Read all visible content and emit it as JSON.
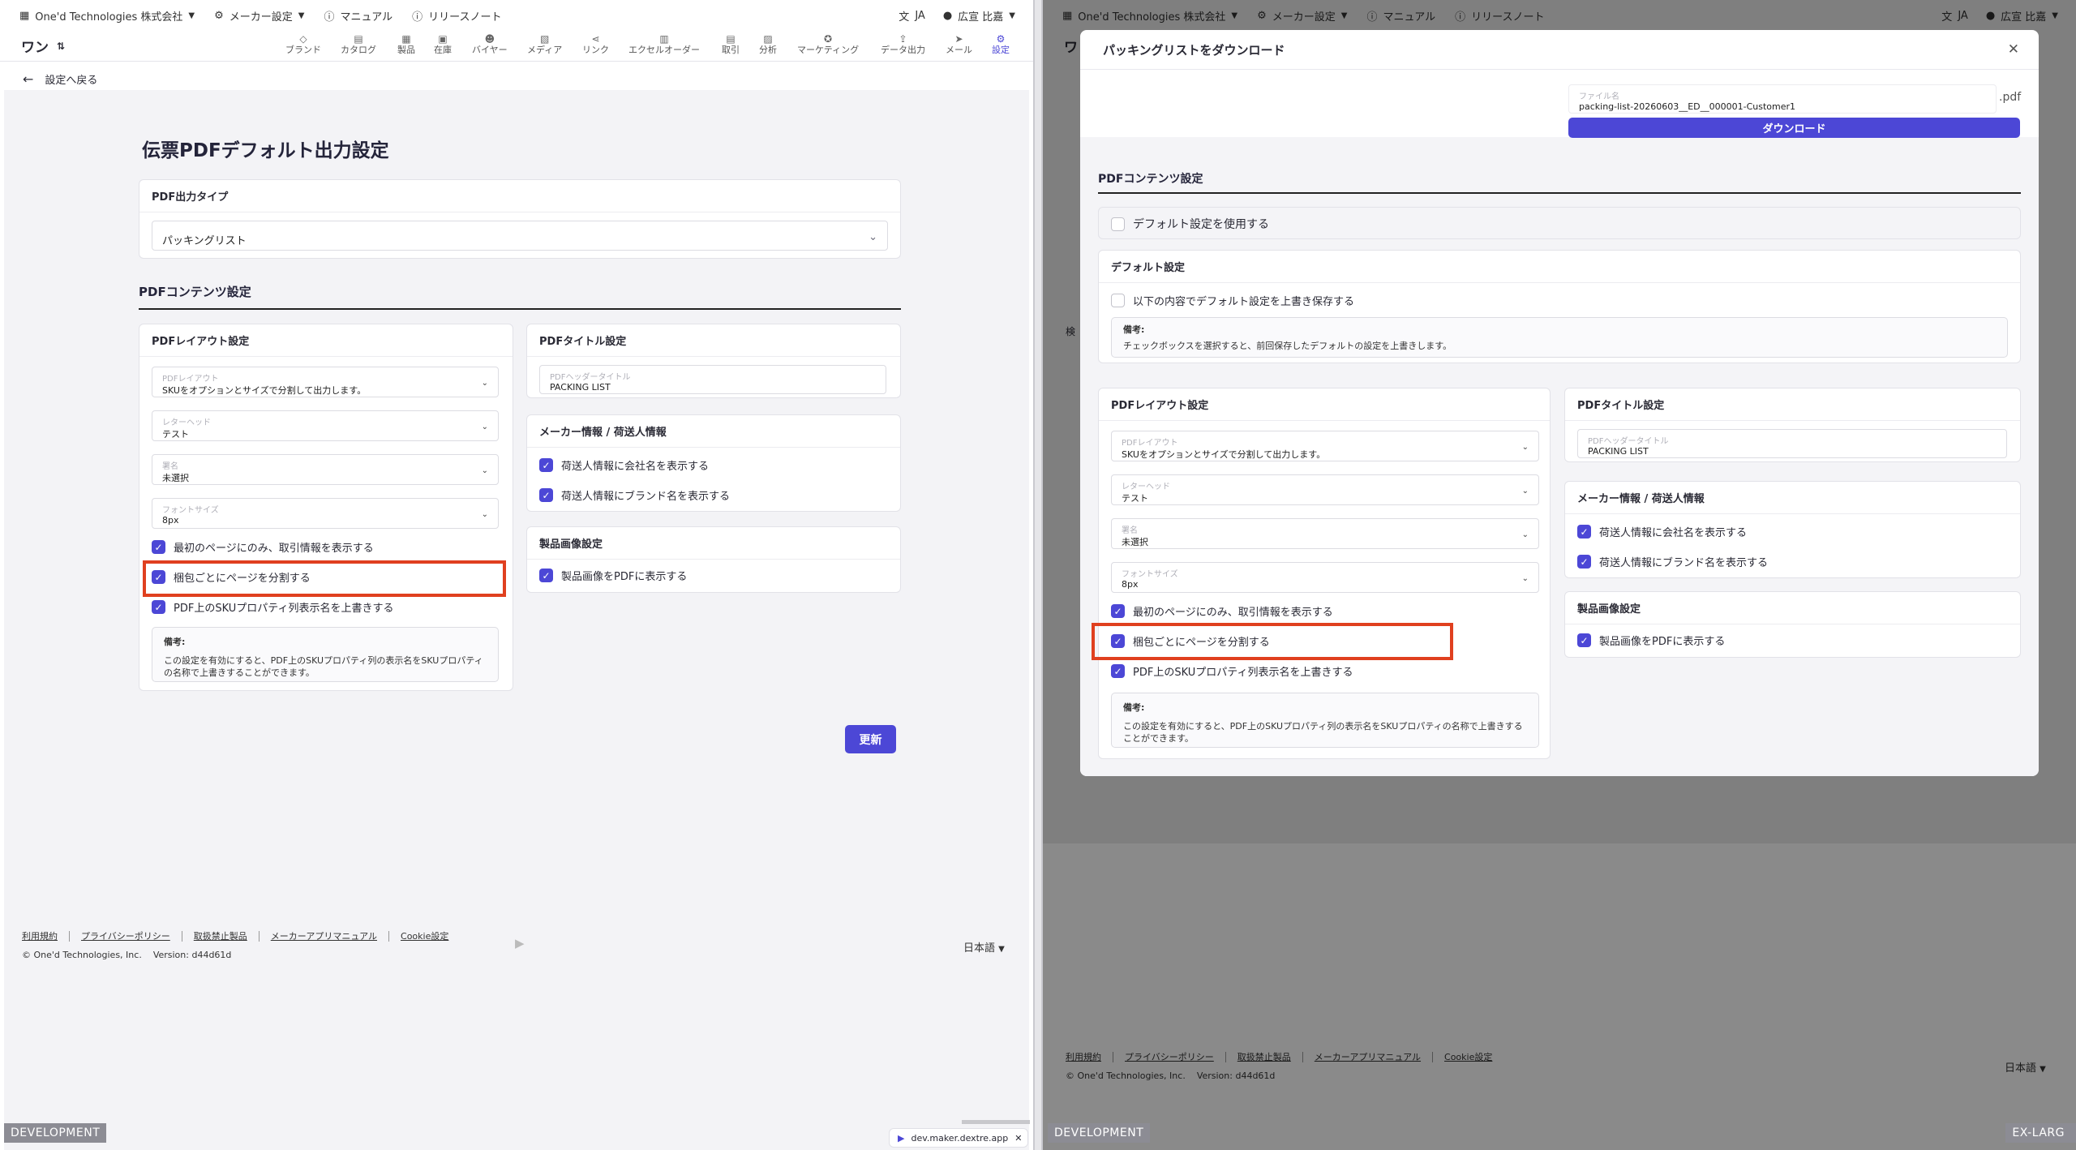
{
  "topbar": {
    "company": "One'd Technologies 株式会社",
    "maker_settings": "メーカー設定",
    "manual": "マニュアル",
    "release_notes": "リリースノート",
    "lang": "JA",
    "user": "広宣 比嘉"
  },
  "nav": {
    "logo": "ワン",
    "items": [
      "ブランド",
      "カタログ",
      "製品",
      "在庫",
      "バイヤー",
      "メディア",
      "リンク",
      "エクセルオーダー",
      "取引",
      "分析",
      "マーケティング",
      "データ出力",
      "メール",
      "設定"
    ]
  },
  "back_label": "設定へ戻る",
  "page_title": "伝票PDFデフォルト出力設定",
  "output_type": {
    "heading": "PDF出力タイプ",
    "value": "パッキングリスト"
  },
  "pdf_contents_heading": "PDFコンテンツ設定",
  "layout": {
    "heading": "PDFレイアウト設定",
    "fields": [
      {
        "label": "PDFレイアウト",
        "value": "SKUをオプションとサイズで分割して出力します。"
      },
      {
        "label": "レターヘッド",
        "value": "テスト"
      },
      {
        "label": "署名",
        "value": "未選択"
      },
      {
        "label": "フォントサイズ",
        "value": "8px"
      }
    ],
    "checks": [
      {
        "label": "最初のページにのみ、取引情報を表示する",
        "checked": true
      },
      {
        "label": "梱包ごとにページを分割する",
        "checked": true
      },
      {
        "label": "PDF上のSKUプロパティ列表示名を上書きする",
        "checked": true
      }
    ],
    "note_title": "備考:",
    "note_text": "この設定を有効にすると、PDF上のSKUプロパティ列の表示名をSKUプロパティの名称で上書きすることができます。"
  },
  "title_settings": {
    "heading": "PDFタイトル設定",
    "field_label": "PDFヘッダータイトル",
    "field_value": "PACKING LIST"
  },
  "maker_info": {
    "heading": "メーカー情報 / 荷送人情報",
    "checks": [
      {
        "label": "荷送人情報に会社名を表示する",
        "checked": true
      },
      {
        "label": "荷送人情報にブランド名を表示する",
        "checked": true
      }
    ]
  },
  "product_image": {
    "heading": "製品画像設定",
    "checks": [
      {
        "label": "製品画像をPDFに表示する",
        "checked": true
      }
    ]
  },
  "update_button": "更新",
  "footer": {
    "links": [
      "利用規約",
      "プライバシーポリシー",
      "取扱禁止製品",
      "メーカーアプリマニュアル",
      "Cookie設定"
    ],
    "copyright": "© One'd Technologies, Inc.",
    "version": "Version: d44d61d",
    "language": "日本語"
  },
  "dev_tag": "DEVELOPMENT",
  "size_tag": "EX-LARG",
  "bg_fragments": {
    "nav_logo_partial": "ワ",
    "label_partial": "検"
  },
  "tooltip": {
    "url": "dev.maker.dextre.app"
  },
  "modal": {
    "title": "パッキングリストをダウンロード",
    "filename_label": "ファイル名",
    "filename_value": "packing-list-20260603__ED__000001-Customer1",
    "ext": ".pdf",
    "download_button": "ダウンロード",
    "pdf_contents_heading": "PDFコンテンツ設定",
    "use_default": {
      "label": "デフォルト設定を使用する",
      "checked": false
    },
    "default_settings": {
      "heading": "デフォルト設定",
      "overwrite": {
        "label": "以下の内容でデフォルト設定を上書き保存する",
        "checked": false
      },
      "note_title": "備考:",
      "note_text": "チェックボックスを選択すると、前回保存したデフォルトの設定を上書きします。"
    }
  },
  "colors": {
    "accent": "#4c47d6",
    "highlight": "#e0401f"
  }
}
